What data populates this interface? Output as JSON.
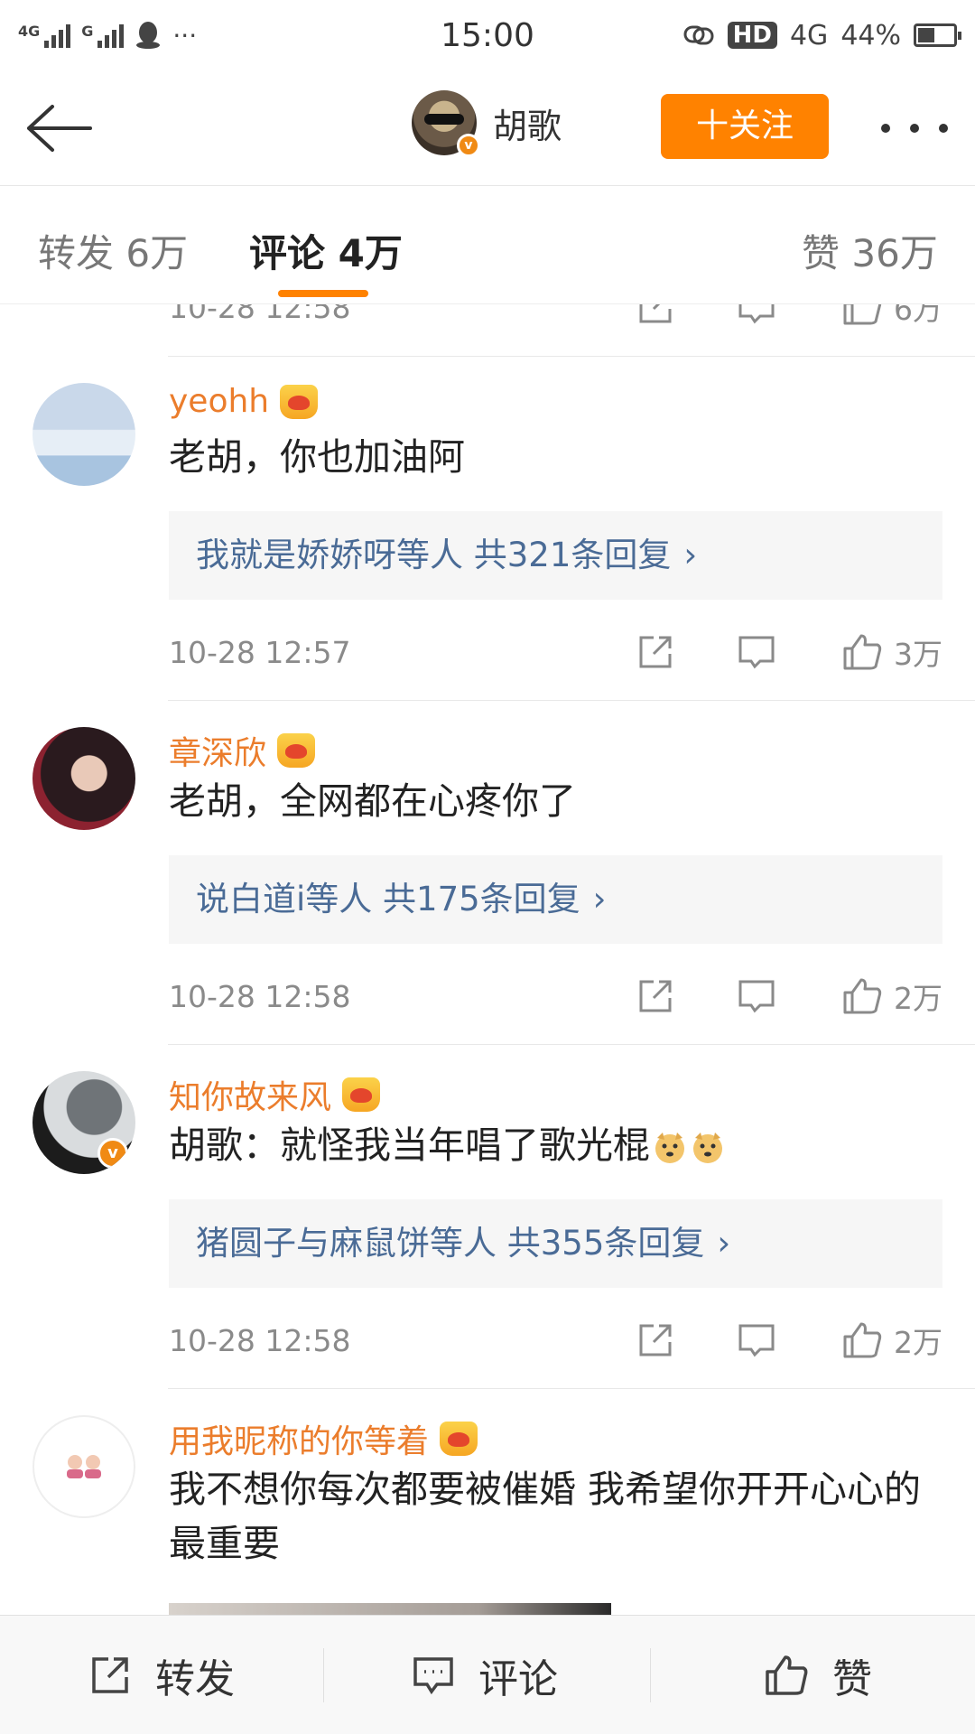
{
  "status_bar": {
    "signal1": "4G",
    "signal2": "G",
    "time": "15:00",
    "hd": "HD",
    "network": "4G",
    "battery": "44%",
    "battery_level": 0.44
  },
  "header": {
    "name": "胡歌",
    "follow_label": "十关注"
  },
  "tabs": [
    {
      "label": "转发",
      "count": "6万"
    },
    {
      "label": "评论",
      "count": "4万"
    },
    {
      "label": "赞",
      "count": "36万"
    }
  ],
  "partial_comment": {
    "time": "10-28 12:58",
    "likes": "6万"
  },
  "comments": [
    {
      "username": "yeohh",
      "text": "老胡，你也加油阿",
      "reply_names": "我就是娇娇呀等人",
      "reply_count": "共321条回复",
      "time": "10-28 12:57",
      "likes": "3万"
    },
    {
      "username": "章深欣",
      "text": "老胡，全网都在心疼你了",
      "reply_names": "说白道i等人",
      "reply_count": "共175条回复",
      "time": "10-28 12:58",
      "likes": "2万"
    },
    {
      "username": "知你故来风",
      "text": "胡歌：就怪我当年唱了歌光棍",
      "reply_names": "猪圆子与麻鼠饼等人",
      "reply_count": "共355条回复",
      "time": "10-28 12:58",
      "likes": "2万"
    },
    {
      "username": "用我昵称的你等着",
      "text": "我不想你每次都要被催婚 我希望你开开心心的最重要"
    }
  ],
  "bottom_bar": {
    "repost": "转发",
    "comment": "评论",
    "like": "赞"
  },
  "colors": {
    "accent": "#ff8200",
    "username": "#eb7d2c",
    "reply_link": "#4a6b96"
  }
}
